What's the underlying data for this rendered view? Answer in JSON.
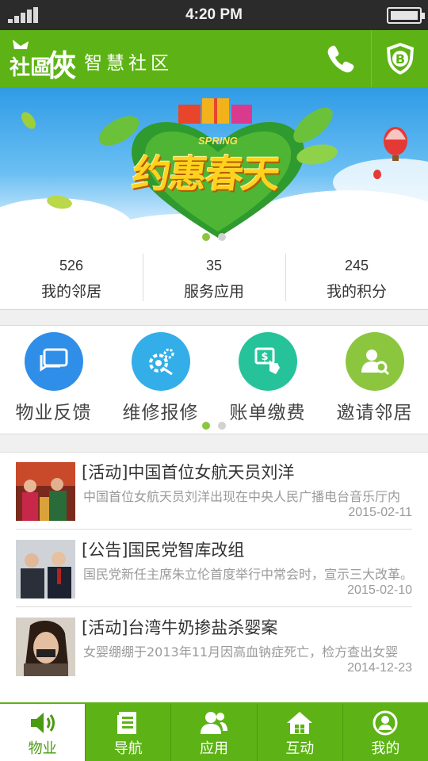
{
  "status_bar": {
    "time": "4:20 PM"
  },
  "header": {
    "brand": "社區俠",
    "slogan": "智慧社区",
    "phone_icon": "phone-icon",
    "shield_icon": "shield-bitcoin-icon",
    "accent": "#5db315"
  },
  "banner": {
    "headline": "约惠春天",
    "tag": "SPRING",
    "pages": 2,
    "active_page": 1
  },
  "stats": [
    {
      "value": "526",
      "label": "我的邻居"
    },
    {
      "value": "35",
      "label": "服务应用"
    },
    {
      "value": "245",
      "label": "我的积分"
    }
  ],
  "services": [
    {
      "label": "物业反馈",
      "icon": "feedback-chat-icon",
      "color": "#2f8ee8"
    },
    {
      "label": "维修报修",
      "icon": "repair-gears-icon",
      "color": "#33aee8"
    },
    {
      "label": "账单缴费",
      "icon": "bill-payment-icon",
      "color": "#26c39a"
    },
    {
      "label": "邀请邻居",
      "icon": "invite-neighbor-icon",
      "color": "#8cc63f"
    }
  ],
  "news": [
    {
      "title": "[活动]中国首位女航天员刘洋",
      "desc": "中国首位女航天员刘洋出现在中央人民广播电台音乐厅内",
      "date": "2015-02-11"
    },
    {
      "title": "[公告]国民党智库改组",
      "desc": "国民党新任主席朱立伦首度举行中常会时，宣示三大改革。",
      "date": "2015-02-10"
    },
    {
      "title": "[活动]台湾牛奶掺盐杀婴案",
      "desc": "女婴绷绷于2013年11月因高血钠症死亡，检方查出女婴",
      "date": "2014-12-23"
    }
  ],
  "tabs": [
    {
      "label": "物业",
      "icon": "speaker-icon",
      "active": true
    },
    {
      "label": "导航",
      "icon": "document-icon",
      "active": false
    },
    {
      "label": "应用",
      "icon": "people-icon",
      "active": false
    },
    {
      "label": "互动",
      "icon": "home-icon",
      "active": false
    },
    {
      "label": "我的",
      "icon": "user-icon",
      "active": false
    }
  ]
}
